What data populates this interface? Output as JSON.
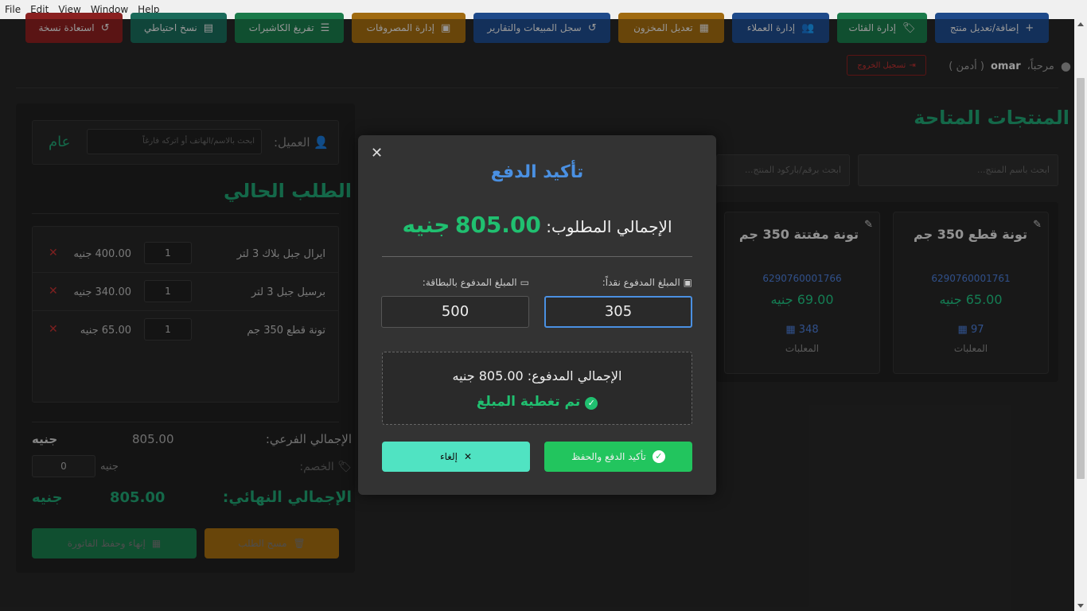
{
  "menu": [
    "File",
    "Edit",
    "View",
    "Window",
    "Help"
  ],
  "toolbar": [
    {
      "label": "إضافة/تعديل منتج",
      "icon": "+",
      "color": "#1e4a8a"
    },
    {
      "label": "إدارة الفئات",
      "icon": "🏷",
      "color": "#1a7a4a"
    },
    {
      "label": "إدارة العملاء",
      "icon": "👥",
      "color": "#1e4a8a"
    },
    {
      "label": "تعديل المخزون",
      "icon": "▦",
      "color": "#a06a10"
    },
    {
      "label": "سجل المبيعات والتقارير",
      "icon": "↺",
      "color": "#1e4a8a"
    },
    {
      "label": "إدارة المصروفات",
      "icon": "▣",
      "color": "#a06a10"
    },
    {
      "label": "تفريغ الكاشيرات",
      "icon": "☰",
      "color": "#1a7a4a"
    },
    {
      "label": "نسخ احتياطي",
      "icon": "▤",
      "color": "#1a6a5a"
    },
    {
      "label": "استعادة نسخة",
      "icon": "↺",
      "color": "#8a2020"
    }
  ],
  "header": {
    "welcome": "مرحباً،",
    "user": "omar",
    "role": "( أدمن )",
    "logout": "تسجيل الخروج"
  },
  "products": {
    "title": "المنتجات المتاحة",
    "search_name_placeholder": "ابحث باسم المنتج...",
    "search_barcode_placeholder": "ابحث برقم/باركود المنتج...",
    "cards": [
      {
        "name": "تونة قطع 350 جم",
        "barcode": "6290760001761",
        "price": "65.00 جنيه",
        "stock": "97",
        "stock_label": "المعلبات"
      },
      {
        "name": "تونة مفتتة 350 جم",
        "barcode": "6290760001766",
        "price": "69.00 جنيه",
        "stock": "348",
        "stock_label": "المعلبات"
      }
    ]
  },
  "cart": {
    "customer_label": "العميل:",
    "customer_placeholder": "ابحث بالاسم/الهاتف أو اتركه فارغاً",
    "customer_value": "عام",
    "order_title": "الطلب الحالي",
    "items": [
      {
        "name": "ايرال جبل بلاك 3 لتر",
        "qty": "1",
        "price": "400.00 جنيه"
      },
      {
        "name": "برسيل جبل 3 لتر",
        "qty": "1",
        "price": "340.00 جنيه"
      },
      {
        "name": "تونة قطع 350 جم",
        "qty": "1",
        "price": "65.00 جنيه"
      }
    ],
    "subtotal_label": "الإجمالي الفرعي:",
    "subtotal_value": "805.00",
    "currency": "جنيه",
    "discount_label": "الخصم:",
    "discount_value": "0",
    "final_label": "الإجمالي النهائي:",
    "final_value": "805.00",
    "clear_label": "مسح الطلب",
    "finish_label": "إنهاء وحفظ الفاتورة"
  },
  "modal": {
    "title": "تأكيد الدفع",
    "total_label": "الإجمالي المطلوب:",
    "total_amount": "805.00",
    "total_currency": "جنيه",
    "cash_label": "المبلغ المدفوع نقداً:",
    "cash_value": "305",
    "card_label": "المبلغ المدفوع بالبطاقة:",
    "card_value": "500",
    "paid_total": "الإجمالي المدفوع: 805.00 جنيه",
    "covered": "تم تغطية المبلغ",
    "confirm_label": "تأكيد الدفع والحفظ",
    "cancel_label": "إلغاء"
  }
}
